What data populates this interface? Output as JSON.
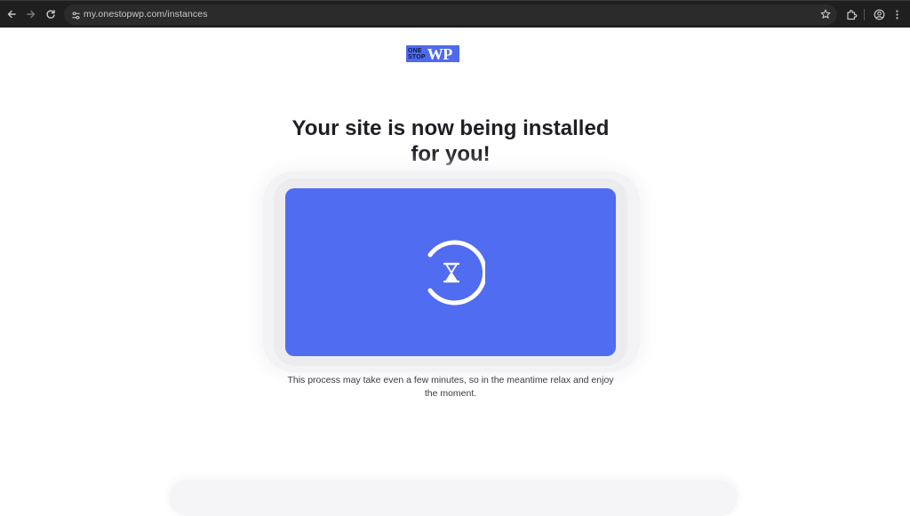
{
  "browser": {
    "url": "my.onestopwp.com/instances",
    "icons": {
      "back": "arrow-left-icon",
      "forward": "arrow-right-icon",
      "reload": "reload-icon",
      "site_info": "tune-icon",
      "bookmark": "star-icon",
      "extensions": "puzzle-icon",
      "profile": "account-circle-icon",
      "menu": "more-vert-icon"
    }
  },
  "logo": {
    "line1": "ONE",
    "line2": "STOP",
    "mark": "WP"
  },
  "main": {
    "title_line1": "Your site is now being installed",
    "title_line2": "for you!",
    "progress_icon": "hourglass-icon",
    "note_line1": "This process may take even a few minutes, so in the meantime relax and enjoy",
    "note_line2": "the moment."
  },
  "colors": {
    "accent": "#506cf0",
    "logo_bg": "#4f6bed",
    "title": "#1e1e24",
    "browser_bg": "#1f1f1f"
  }
}
